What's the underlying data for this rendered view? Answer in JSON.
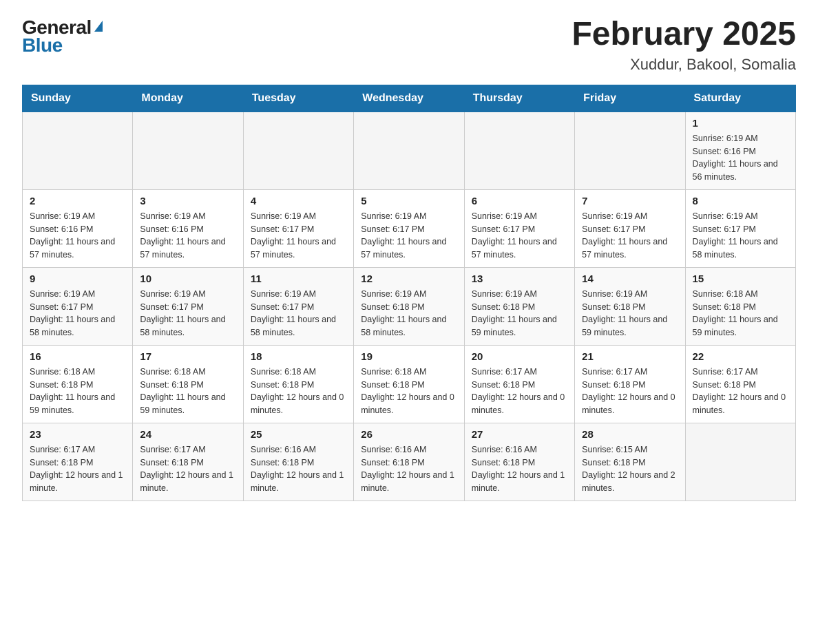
{
  "logo": {
    "general": "General",
    "blue": "Blue",
    "triangle": "▲"
  },
  "title": "February 2025",
  "subtitle": "Xuddur, Bakool, Somalia",
  "days_header": [
    "Sunday",
    "Monday",
    "Tuesday",
    "Wednesday",
    "Thursday",
    "Friday",
    "Saturday"
  ],
  "weeks": [
    [
      {
        "day": "",
        "info": ""
      },
      {
        "day": "",
        "info": ""
      },
      {
        "day": "",
        "info": ""
      },
      {
        "day": "",
        "info": ""
      },
      {
        "day": "",
        "info": ""
      },
      {
        "day": "",
        "info": ""
      },
      {
        "day": "1",
        "info": "Sunrise: 6:19 AM\nSunset: 6:16 PM\nDaylight: 11 hours and 56 minutes."
      }
    ],
    [
      {
        "day": "2",
        "info": "Sunrise: 6:19 AM\nSunset: 6:16 PM\nDaylight: 11 hours and 57 minutes."
      },
      {
        "day": "3",
        "info": "Sunrise: 6:19 AM\nSunset: 6:16 PM\nDaylight: 11 hours and 57 minutes."
      },
      {
        "day": "4",
        "info": "Sunrise: 6:19 AM\nSunset: 6:17 PM\nDaylight: 11 hours and 57 minutes."
      },
      {
        "day": "5",
        "info": "Sunrise: 6:19 AM\nSunset: 6:17 PM\nDaylight: 11 hours and 57 minutes."
      },
      {
        "day": "6",
        "info": "Sunrise: 6:19 AM\nSunset: 6:17 PM\nDaylight: 11 hours and 57 minutes."
      },
      {
        "day": "7",
        "info": "Sunrise: 6:19 AM\nSunset: 6:17 PM\nDaylight: 11 hours and 57 minutes."
      },
      {
        "day": "8",
        "info": "Sunrise: 6:19 AM\nSunset: 6:17 PM\nDaylight: 11 hours and 58 minutes."
      }
    ],
    [
      {
        "day": "9",
        "info": "Sunrise: 6:19 AM\nSunset: 6:17 PM\nDaylight: 11 hours and 58 minutes."
      },
      {
        "day": "10",
        "info": "Sunrise: 6:19 AM\nSunset: 6:17 PM\nDaylight: 11 hours and 58 minutes."
      },
      {
        "day": "11",
        "info": "Sunrise: 6:19 AM\nSunset: 6:17 PM\nDaylight: 11 hours and 58 minutes."
      },
      {
        "day": "12",
        "info": "Sunrise: 6:19 AM\nSunset: 6:18 PM\nDaylight: 11 hours and 58 minutes."
      },
      {
        "day": "13",
        "info": "Sunrise: 6:19 AM\nSunset: 6:18 PM\nDaylight: 11 hours and 59 minutes."
      },
      {
        "day": "14",
        "info": "Sunrise: 6:19 AM\nSunset: 6:18 PM\nDaylight: 11 hours and 59 minutes."
      },
      {
        "day": "15",
        "info": "Sunrise: 6:18 AM\nSunset: 6:18 PM\nDaylight: 11 hours and 59 minutes."
      }
    ],
    [
      {
        "day": "16",
        "info": "Sunrise: 6:18 AM\nSunset: 6:18 PM\nDaylight: 11 hours and 59 minutes."
      },
      {
        "day": "17",
        "info": "Sunrise: 6:18 AM\nSunset: 6:18 PM\nDaylight: 11 hours and 59 minutes."
      },
      {
        "day": "18",
        "info": "Sunrise: 6:18 AM\nSunset: 6:18 PM\nDaylight: 12 hours and 0 minutes."
      },
      {
        "day": "19",
        "info": "Sunrise: 6:18 AM\nSunset: 6:18 PM\nDaylight: 12 hours and 0 minutes."
      },
      {
        "day": "20",
        "info": "Sunrise: 6:17 AM\nSunset: 6:18 PM\nDaylight: 12 hours and 0 minutes."
      },
      {
        "day": "21",
        "info": "Sunrise: 6:17 AM\nSunset: 6:18 PM\nDaylight: 12 hours and 0 minutes."
      },
      {
        "day": "22",
        "info": "Sunrise: 6:17 AM\nSunset: 6:18 PM\nDaylight: 12 hours and 0 minutes."
      }
    ],
    [
      {
        "day": "23",
        "info": "Sunrise: 6:17 AM\nSunset: 6:18 PM\nDaylight: 12 hours and 1 minute."
      },
      {
        "day": "24",
        "info": "Sunrise: 6:17 AM\nSunset: 6:18 PM\nDaylight: 12 hours and 1 minute."
      },
      {
        "day": "25",
        "info": "Sunrise: 6:16 AM\nSunset: 6:18 PM\nDaylight: 12 hours and 1 minute."
      },
      {
        "day": "26",
        "info": "Sunrise: 6:16 AM\nSunset: 6:18 PM\nDaylight: 12 hours and 1 minute."
      },
      {
        "day": "27",
        "info": "Sunrise: 6:16 AM\nSunset: 6:18 PM\nDaylight: 12 hours and 1 minute."
      },
      {
        "day": "28",
        "info": "Sunrise: 6:15 AM\nSunset: 6:18 PM\nDaylight: 12 hours and 2 minutes."
      },
      {
        "day": "",
        "info": ""
      }
    ]
  ]
}
